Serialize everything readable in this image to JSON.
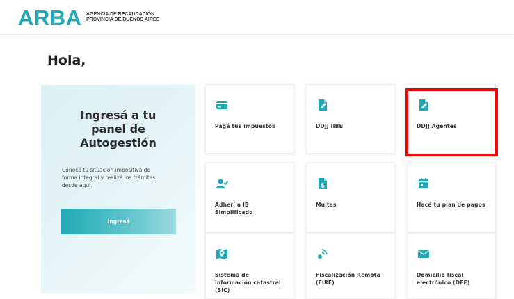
{
  "header": {
    "logo": "ARBA",
    "agency_line1": "AGENCIA DE RECAUDACIÓN",
    "agency_line2": "PROVINCIA DE BUENOS AIRES"
  },
  "greeting": "Hola,",
  "panel": {
    "title_line1": "Ingresá a tu",
    "title_line2": "panel de",
    "title_line3": "Autogestión",
    "desc_line1": "Conocé tu situación impositiva de",
    "desc_line2": "forma integral y realizá los trámites",
    "desc_line3": "desde aquí.",
    "button": "Ingresá"
  },
  "cards": [
    {
      "line1": "Pagá tus impuestos",
      "line2": "",
      "line3": "",
      "icon": "credit-card-icon"
    },
    {
      "line1": "DDJJ IIBB",
      "line2": "",
      "line3": "",
      "icon": "document-edit-icon"
    },
    {
      "line1": "DDJJ Agentes",
      "line2": "",
      "line3": "",
      "icon": "document-edit-icon"
    },
    {
      "line1": "Adherí a IB",
      "line2": "Simplificado",
      "line3": "",
      "icon": "user-check-icon"
    },
    {
      "line1": "Multas",
      "line2": "",
      "line3": "",
      "icon": "dollar-document-icon"
    },
    {
      "line1": "Hacé tu plan de pagos",
      "line2": "",
      "line3": "",
      "icon": "calendar-icon"
    },
    {
      "line1": "Sistema de",
      "line2": "información catastral",
      "line3": "(SIC)",
      "icon": "map-pin-icon"
    },
    {
      "line1": "Fiscalización Remota",
      "line2": "(FIRE)",
      "line3": "",
      "icon": "satellite-icon"
    },
    {
      "line1": "Domicilio fiscal",
      "line2": "electrónico (DFE)",
      "line3": "",
      "icon": "envelope-icon"
    }
  ],
  "colors": {
    "brand": "#1fa9b4",
    "highlight": "#ff0000"
  }
}
